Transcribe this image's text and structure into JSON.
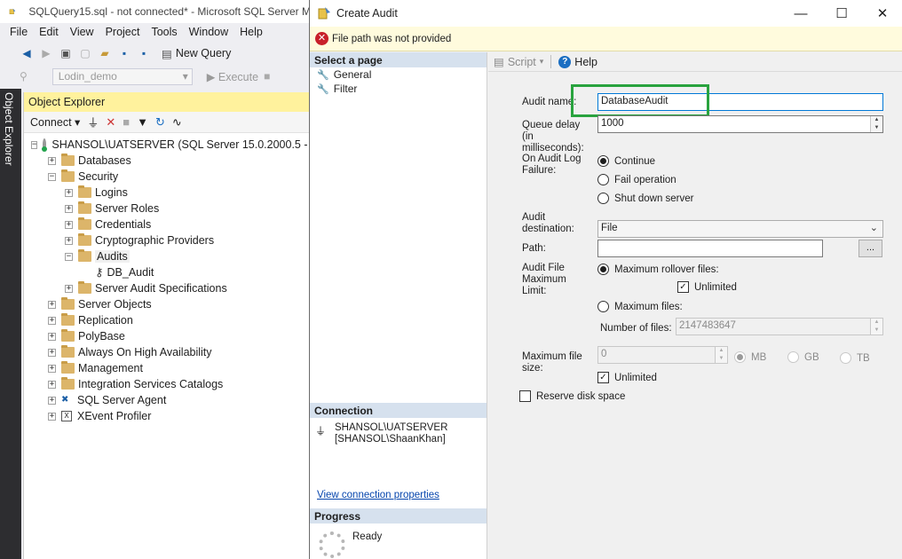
{
  "ssms": {
    "title": "SQLQuery15.sql - not connected* - Microsoft SQL Server M",
    "menu": [
      "File",
      "Edit",
      "View",
      "Project",
      "Tools",
      "Window",
      "Help"
    ],
    "toolbar": {
      "new_query": "New Query",
      "database": "Lodin_demo",
      "execute": "Execute"
    },
    "side_tab": "Object Explorer",
    "object_explorer": {
      "header": "Object Explorer",
      "connect": "Connect",
      "server": "SHANSOL\\UATSERVER (SQL Server 15.0.2000.5 - SHA",
      "nodes": {
        "databases": "Databases",
        "security": "Security",
        "logins": "Logins",
        "server_roles": "Server Roles",
        "credentials": "Credentials",
        "crypto": "Cryptographic Providers",
        "audits": "Audits",
        "db_audit": "DB_Audit",
        "server_audit_specs": "Server Audit Specifications",
        "server_objects": "Server Objects",
        "replication": "Replication",
        "polybase": "PolyBase",
        "always_on": "Always On High Availability",
        "management": "Management",
        "integration": "Integration Services Catalogs",
        "agent": "SQL Server Agent",
        "xevent": "XEvent Profiler"
      }
    }
  },
  "dialog": {
    "title": "Create Audit",
    "message": "File path was not provided",
    "select_page": {
      "header": "Select a page",
      "items": [
        "General",
        "Filter"
      ]
    },
    "connection": {
      "header": "Connection",
      "server": "SHANSOL\\UATSERVER",
      "user": "[SHANSOL\\ShaanKhan]",
      "view_link": "View connection properties"
    },
    "progress": {
      "header": "Progress",
      "status": "Ready"
    },
    "toolbar": {
      "script": "Script",
      "help": "Help"
    },
    "form": {
      "audit_name_label": "Audit name:",
      "audit_name_value": "DatabaseAudit",
      "queue_delay_label": "Queue delay (in milliseconds):",
      "queue_delay_value": "1000",
      "on_failure_label": "On Audit Log Failure:",
      "on_failure_options": [
        "Continue",
        "Fail operation",
        "Shut down server"
      ],
      "on_failure_selected": "Continue",
      "destination_label": "Audit destination:",
      "destination_value": "File",
      "path_label": "Path:",
      "path_value": "",
      "browse_button": "...",
      "max_limit_label": "Audit File Maximum Limit:",
      "max_rollover_label": "Maximum rollover files:",
      "unlimited_label": "Unlimited",
      "max_files_label": "Maximum files:",
      "number_files_label": "Number of files:",
      "number_files_value": "2147483647",
      "max_file_size_label": "Maximum file size:",
      "max_file_size_value": "0",
      "units": [
        "MB",
        "GB",
        "TB"
      ],
      "size_unlimited_label": "Unlimited",
      "reserve_disk_label": "Reserve disk space"
    }
  },
  "colors": {
    "highlight_box": "#29a33e",
    "error": "#c8202a",
    "oe_header": "#fff29d",
    "section_header": "#d6e1ee"
  }
}
